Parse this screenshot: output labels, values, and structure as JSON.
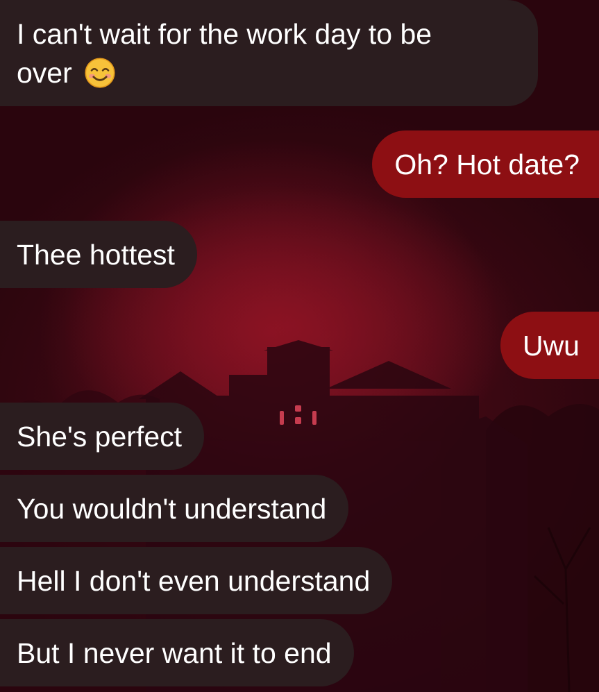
{
  "conversation": {
    "messages": [
      {
        "direction": "incoming",
        "text": "I can't wait for the work day to be",
        "text_line2": "over",
        "emoji": "smiling-face-with-smiling-eyes"
      },
      {
        "direction": "outgoing",
        "text": "Oh? Hot date?"
      },
      {
        "direction": "incoming",
        "text": "Thee hottest"
      },
      {
        "direction": "outgoing",
        "text": "Uwu"
      },
      {
        "direction": "incoming",
        "text": "She's perfect"
      },
      {
        "direction": "incoming",
        "text": "You wouldn't understand"
      },
      {
        "direction": "incoming",
        "text": "Hell I don't even understand"
      },
      {
        "direction": "incoming",
        "text": "But I never want it to end"
      }
    ]
  },
  "colors": {
    "incoming_bubble": "#2b1d1f",
    "outgoing_bubble": "#8d0f13",
    "text": "#ffffff",
    "background": "#4a0a16"
  },
  "wallpaper": {
    "icon": "haunted-house-wallpaper"
  }
}
